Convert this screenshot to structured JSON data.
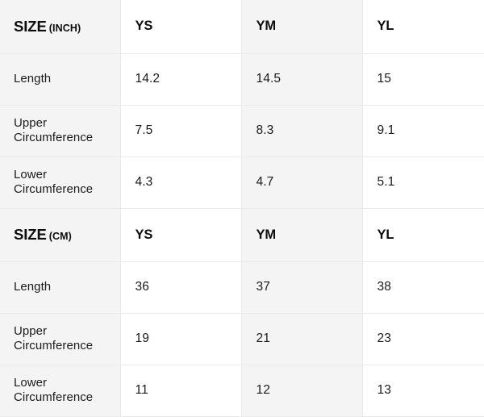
{
  "table": {
    "columns": [
      "SIZE",
      "YS",
      "YM",
      "YL"
    ],
    "sections": [
      {
        "header": {
          "label_main": "SIZE",
          "label_unit": "(INCH)",
          "col1": "YS",
          "col2": "YM",
          "col3": "YL"
        },
        "rows": [
          {
            "label": "Length",
            "values": [
              "14.2",
              "14.5",
              "15"
            ]
          },
          {
            "label": "Upper Circumference",
            "values": [
              "7.5",
              "8.3",
              "9.1"
            ]
          },
          {
            "label": "Lower Circumference",
            "values": [
              "4.3",
              "4.7",
              "5.1"
            ]
          }
        ]
      },
      {
        "header": {
          "label_main": "SIZE",
          "label_unit": "(CM)",
          "col1": "YS",
          "col2": "YM",
          "col3": "YL"
        },
        "rows": [
          {
            "label": "Length",
            "values": [
              "36",
              "37",
              "38"
            ]
          },
          {
            "label": "Upper Circumference",
            "values": [
              "19",
              "21",
              "23"
            ]
          },
          {
            "label": "Lower Circumference",
            "values": [
              "11",
              "12",
              "13"
            ]
          }
        ]
      }
    ]
  },
  "colors": {
    "stripe": "#f4f4f4",
    "background": "#ffffff",
    "border": "#e9e9e9",
    "text": "#1a1a1a",
    "heading": "#0d0d0d"
  }
}
